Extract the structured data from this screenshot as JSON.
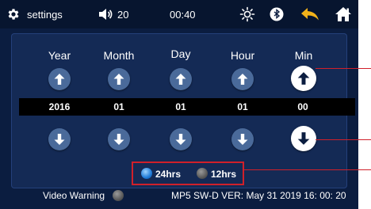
{
  "topbar": {
    "settings_label": "settings",
    "volume": "20",
    "time": "00:40"
  },
  "columns": [
    {
      "label": "Year",
      "value": "2016"
    },
    {
      "label": "Month",
      "value": "01"
    },
    {
      "label": "Day",
      "value": "01"
    },
    {
      "label": "Hour",
      "value": "01"
    },
    {
      "label": "Min",
      "value": "00"
    }
  ],
  "time_format": {
    "option_24": "24hrs",
    "option_12": "12hrs",
    "selected": "24hrs"
  },
  "footer": {
    "video_warning": "Video Warning",
    "version": "MP5 SW-D VER:  May 31 2019 16: 00: 20"
  },
  "colors": {
    "screen_bg": "#0b1d40",
    "accent_yellow": "#f2b21a",
    "annotation_red": "#d0202a",
    "selected_radio": "#1f7bd8"
  },
  "icons": {
    "settings": "gear-icon",
    "volume": "speaker-icon",
    "brightness": "sun-icon",
    "bluetooth": "bluetooth-icon",
    "back": "back-arrow-icon",
    "home": "home-icon"
  }
}
